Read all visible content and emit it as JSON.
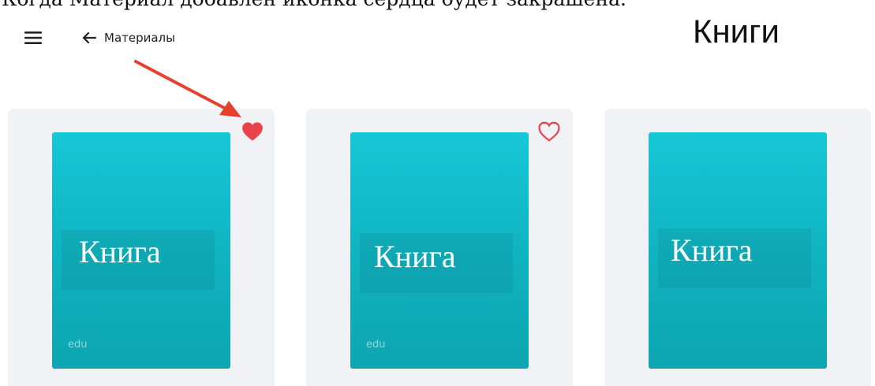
{
  "caption": "Когда Материал добавлен иконка сердца будет закрашена.",
  "header": {
    "menu_icon": "menu-icon",
    "back_label": "Материалы",
    "back_icon": "arrow-left-icon",
    "title": "Книги"
  },
  "colors": {
    "heart": "#e8434b",
    "arrow": "#e8402f",
    "cover_top": "#17c7d6",
    "cover_bottom": "#0ea6b0",
    "card_bg": "#f1f2f5"
  },
  "cards": [
    {
      "cover_title": "Книга",
      "cover_tag": "edu",
      "favorite": true
    },
    {
      "cover_title": "Книга",
      "cover_tag": "edu",
      "favorite": false
    },
    {
      "cover_title": "Книга",
      "cover_tag": "",
      "favorite": null
    }
  ]
}
